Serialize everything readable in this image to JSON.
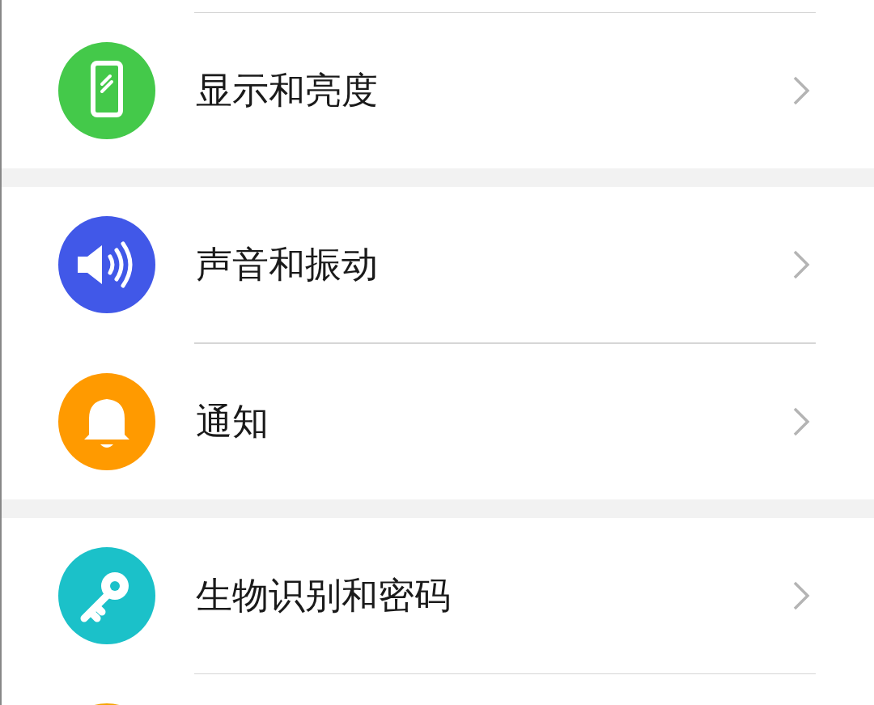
{
  "groups": [
    {
      "items": [
        {
          "label": "显示和亮度",
          "kind": "display",
          "color": "#44c94a"
        }
      ]
    },
    {
      "items": [
        {
          "label": "声音和振动",
          "kind": "sound",
          "color": "#4158e8"
        },
        {
          "label": "通知",
          "kind": "bell",
          "color": "#ff9a00"
        }
      ]
    },
    {
      "items": [
        {
          "label": "生物识别和密码",
          "kind": "key",
          "color": "#1bc1c9"
        },
        {
          "kind": "blank",
          "color": "#f5a300"
        }
      ]
    }
  ]
}
